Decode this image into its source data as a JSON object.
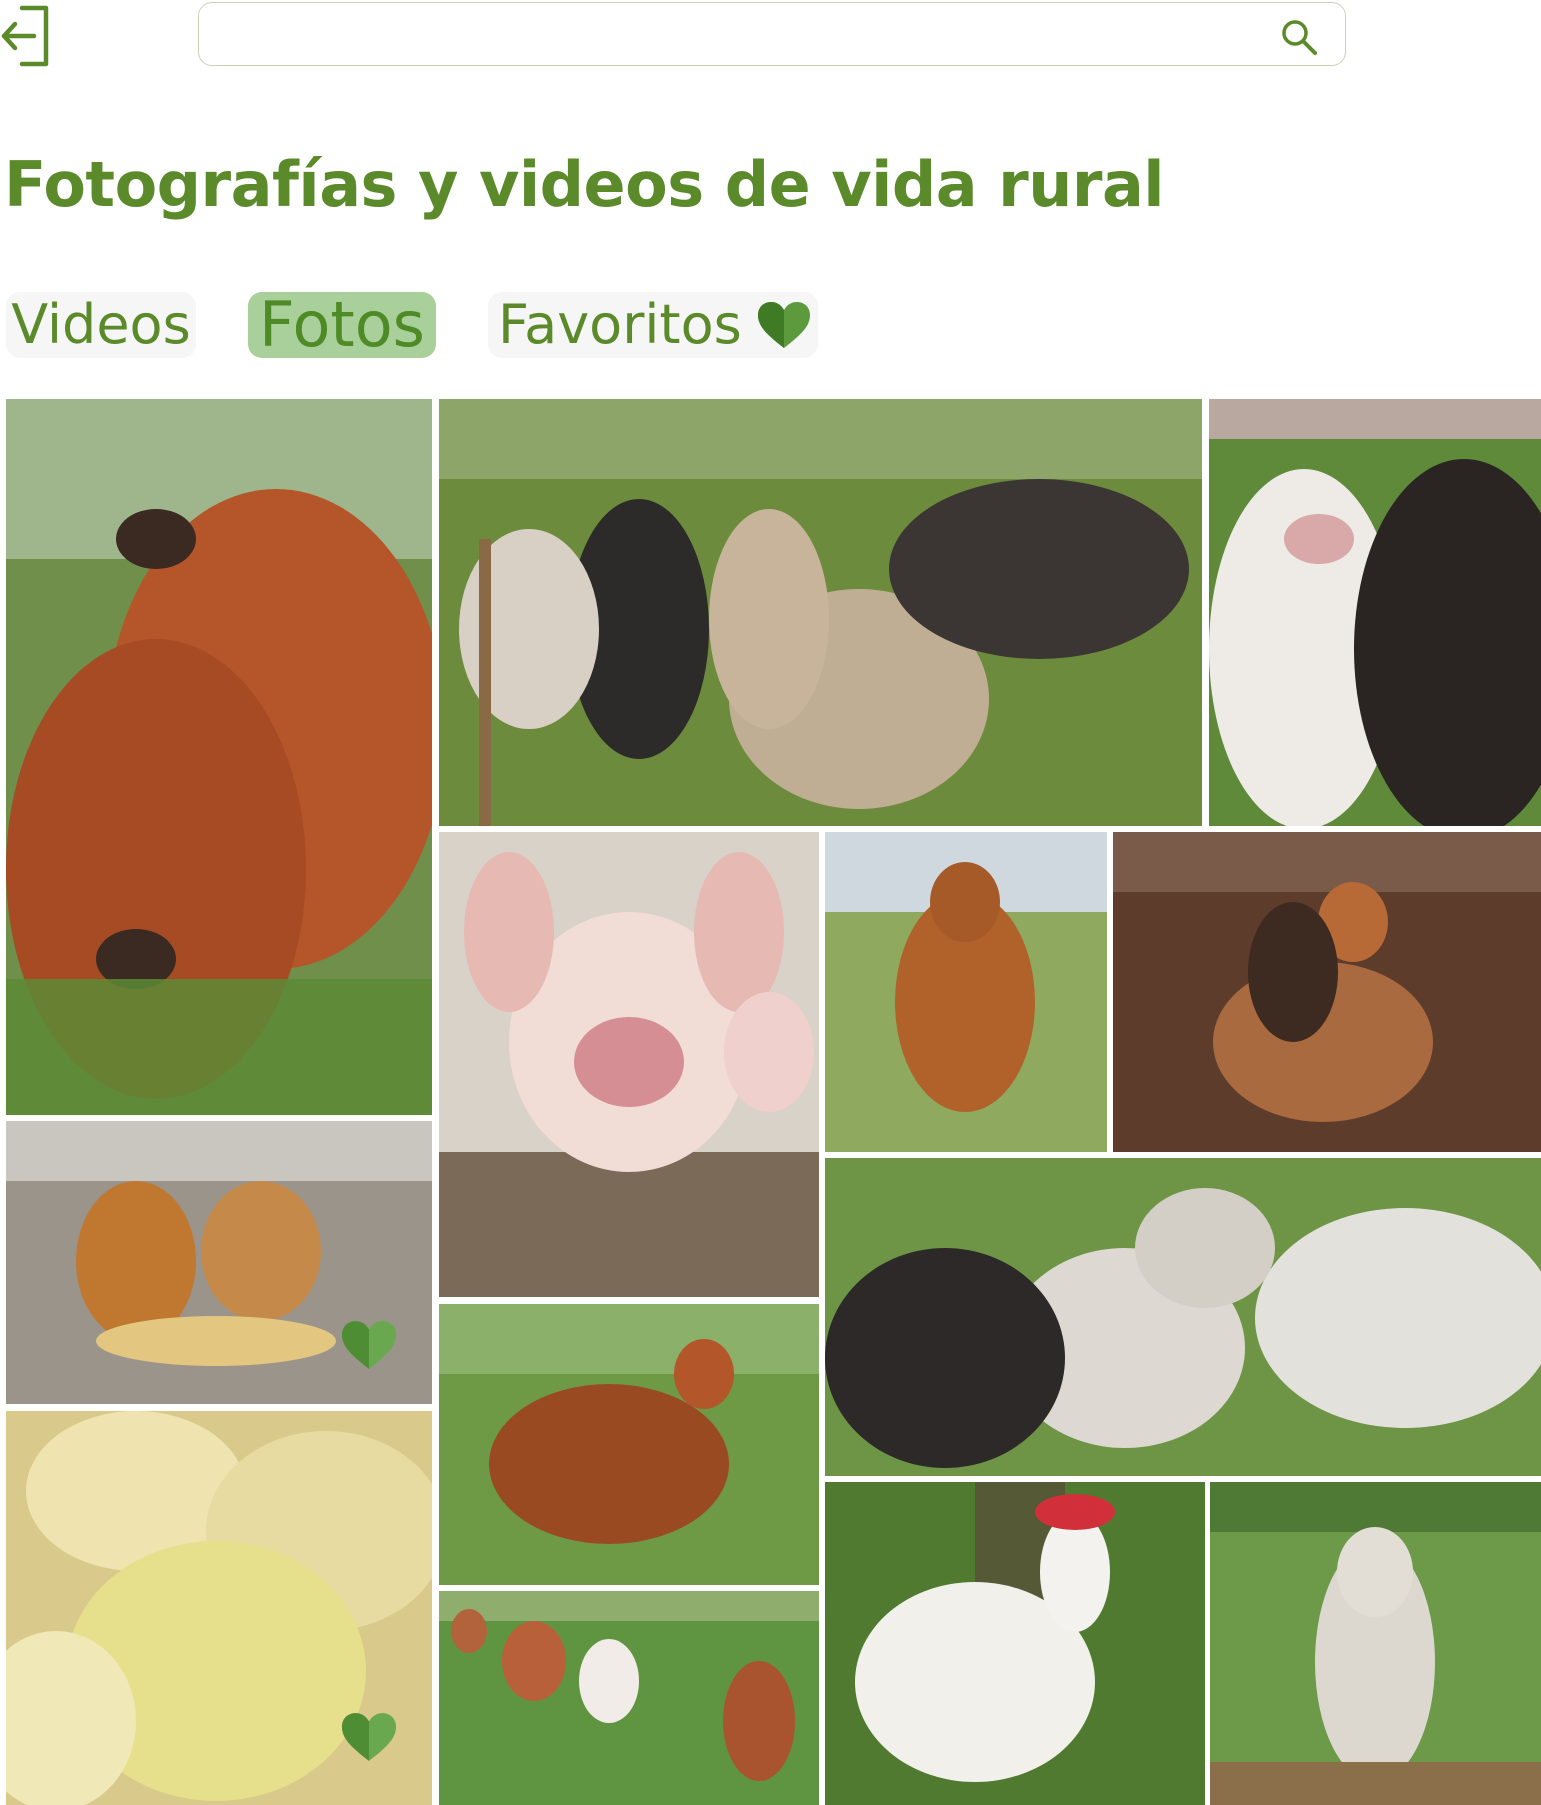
{
  "header": {
    "back_icon": "logout-arrow-left-icon",
    "search": {
      "value": "",
      "placeholder": "",
      "icon": "search-icon"
    }
  },
  "page": {
    "title": "Fotografías y videos de vida rural"
  },
  "tabs": [
    {
      "label": "Videos",
      "active": false
    },
    {
      "label": "Fotos",
      "active": true
    },
    {
      "label": "Favoritos",
      "active": false,
      "icon": "heart-icon"
    }
  ],
  "gallery": {
    "photos": [
      {
        "subject": "two-brown-calves",
        "favorite": false
      },
      {
        "subject": "cattle-herd-at-fence",
        "favorite": false
      },
      {
        "subject": "two-calves-closeup",
        "favorite": false
      },
      {
        "subject": "piglet-closeup",
        "favorite": false
      },
      {
        "subject": "brown-brahman-bull",
        "favorite": false
      },
      {
        "subject": "brown-hen-sitting",
        "favorite": false
      },
      {
        "subject": "hens-with-chicks",
        "favorite": true
      },
      {
        "subject": "yellow-chicks",
        "favorite": true
      },
      {
        "subject": "brown-hen-on-grass",
        "favorite": false
      },
      {
        "subject": "group-of-cattle",
        "favorite": false
      },
      {
        "subject": "pigs-running",
        "favorite": false
      },
      {
        "subject": "white-rooster",
        "favorite": false
      },
      {
        "subject": "white-cow-in-pasture",
        "favorite": false
      }
    ]
  },
  "colors": {
    "brand_green": "#5b8a2b",
    "active_tab_bg": "#a9d09a",
    "heart_green": "#6aa84f"
  }
}
